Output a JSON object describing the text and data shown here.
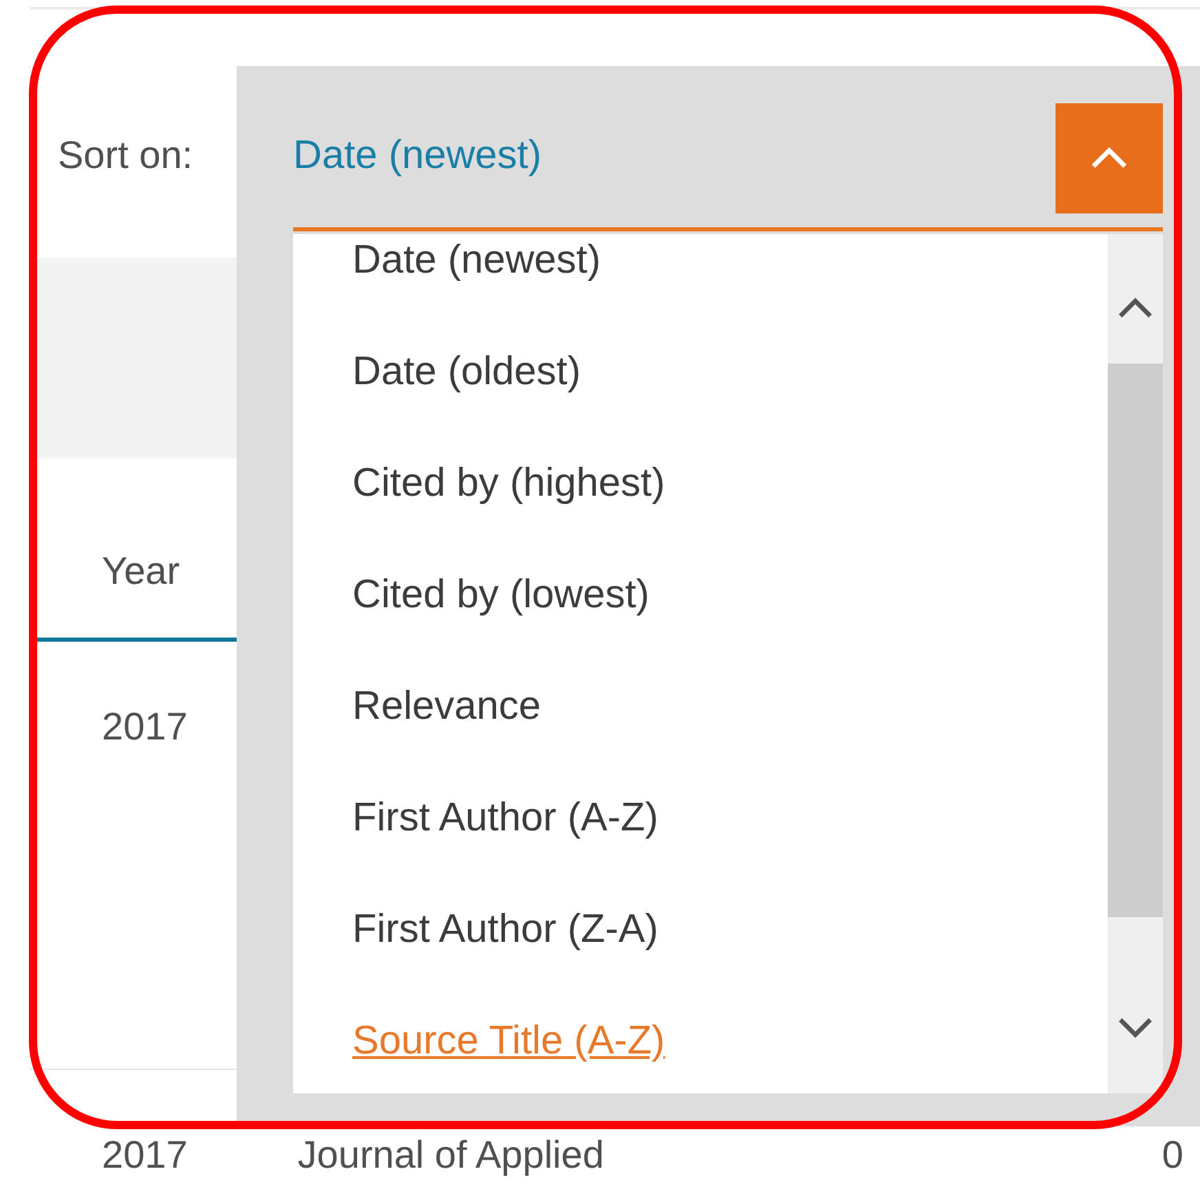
{
  "sort": {
    "label": "Sort on:",
    "value": "Date (newest)",
    "expanded": true,
    "options": [
      {
        "label": "Date (newest)",
        "highlighted": false
      },
      {
        "label": "Date (oldest)",
        "highlighted": false
      },
      {
        "label": "Cited by (highest)",
        "highlighted": false
      },
      {
        "label": "Cited by (lowest)",
        "highlighted": false
      },
      {
        "label": "Relevance",
        "highlighted": false
      },
      {
        "label": "First Author (A-Z)",
        "highlighted": false
      },
      {
        "label": "First Author (Z-A)",
        "highlighted": false
      },
      {
        "label": "Source Title (A-Z)",
        "highlighted": true
      }
    ]
  },
  "table": {
    "columns": [
      "Year"
    ],
    "rows": [
      {
        "year": "2017"
      },
      {
        "year": "2017",
        "source": "Journal of Applied",
        "cited": "0"
      }
    ]
  }
}
